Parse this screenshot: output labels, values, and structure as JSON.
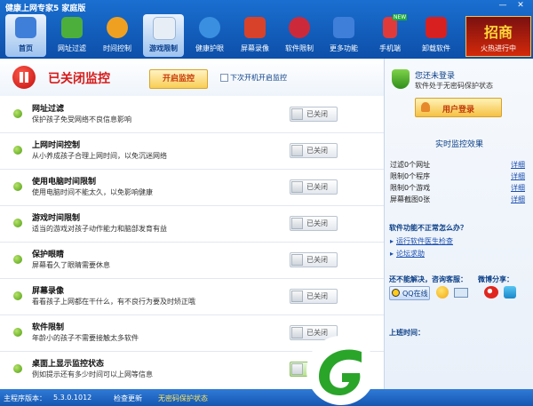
{
  "window": {
    "title": "健康上网专家5 家庭版",
    "minimize": "—",
    "close": "✕"
  },
  "toolbar": {
    "items": [
      {
        "label": "首页",
        "icon": "home-icon",
        "color": "#3f7fd9"
      },
      {
        "label": "网址过滤",
        "icon": "shield-icon",
        "color": "#4caf3c"
      },
      {
        "label": "时间控制",
        "icon": "clock-icon",
        "color": "#f0a020"
      },
      {
        "label": "游戏限制",
        "icon": "gamepad-icon",
        "color": "#e8eef6"
      },
      {
        "label": "健康护眼",
        "icon": "eye-icon",
        "color": "#3a8fe0"
      },
      {
        "label": "屏幕录像",
        "icon": "camera-icon",
        "color": "#d8422a"
      },
      {
        "label": "软件限制",
        "icon": "disc-icon",
        "color": "#cc2a3a"
      },
      {
        "label": "更多功能",
        "icon": "grid-icon",
        "color": "#3f7fd9"
      },
      {
        "label": "手机端",
        "icon": "phone-icon",
        "color": "#e03a3a",
        "badge": "NEW"
      },
      {
        "label": "卸载软件",
        "icon": "uninstall-icon",
        "color": "#d82020"
      }
    ],
    "promo": {
      "main": "招商",
      "sub": "火热进行中"
    }
  },
  "status": {
    "title": "已关闭监控",
    "start_button": "开启监控",
    "autostart_label": "下次开机开启监控"
  },
  "features": [
    {
      "name": "网址过滤",
      "desc": "保护孩子免受网络不良信息影响",
      "state": "已关闭"
    },
    {
      "name": "上网时间控制",
      "desc": "从小养成孩子合理上网时间，以免沉迷网络",
      "state": "已关闭"
    },
    {
      "name": "使用电脑时间限制",
      "desc": "使用电脑时间不能太久，以免影响健康",
      "state": "已关闭"
    },
    {
      "name": "游戏时间限制",
      "desc": "适当的游戏对孩子动作能力和脑部发育有益",
      "state": "已关闭"
    },
    {
      "name": "保护眼睛",
      "desc": "屏幕看久了眼睛需要休息",
      "state": "已关闭"
    },
    {
      "name": "屏幕录像",
      "desc": "看看孩子上网都在干什么，有不良行为要及时矫正哦",
      "state": "已关闭"
    },
    {
      "name": "软件限制",
      "desc": "年龄小的孩子不需要接触太多软件",
      "state": "已关闭"
    },
    {
      "name": "桌面上显示监控状态",
      "desc": "例如提示还有多少时间可以上网等信息",
      "state": "已开"
    }
  ],
  "sidebar": {
    "login_title": "您还未登录",
    "login_sub": "软件处于无密码保护状态",
    "login_button": "用户登录",
    "realtime_title": "实时监控效果",
    "metrics": [
      {
        "text": "过滤0个网址",
        "link": "详细"
      },
      {
        "text": "限制0个程序",
        "link": "详细"
      },
      {
        "text": "限制0个游戏",
        "link": "详细"
      },
      {
        "text": "屏幕截图0张",
        "link": "详细"
      }
    ],
    "problem_title": "软件功能不正常怎么办？",
    "problem_links": [
      "运行软件医生检查",
      "论坛求助"
    ],
    "consult_title": "还不能解决，咨询客服：",
    "share_title": "微博分享：",
    "qq_label": "QQ在线",
    "worktime_label": "上班时间："
  },
  "footer": {
    "version_label": "主程序版本：",
    "version": "5.3.0.1012",
    "update": "检查更新",
    "protect": "无密码保护状态"
  }
}
